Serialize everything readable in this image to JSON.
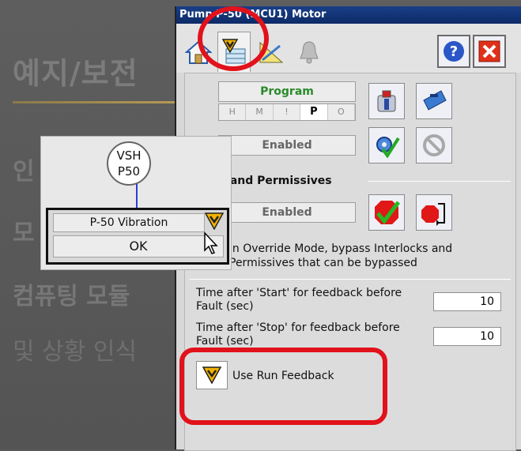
{
  "background_slide": {
    "title": "예지/보전",
    "lines": [
      "인",
      "모",
      "컴퓨팅 모듈",
      "및 상황 인식"
    ]
  },
  "window": {
    "title": "Pump P-50 (MCU1) Motor",
    "tabs": [
      {
        "name": "home",
        "icon": "home-icon"
      },
      {
        "name": "maintenance",
        "icon": "maintenance-wrench-icon",
        "active": true
      },
      {
        "name": "engineering",
        "icon": "engineering-ruler-icon"
      },
      {
        "name": "alarms",
        "icon": "bell-icon"
      }
    ],
    "help_icon": "question-mark-icon",
    "close_icon": "close-x-icon"
  },
  "mode": {
    "program_label": "Program",
    "mode_letters": [
      "H",
      "M",
      "!",
      "P",
      "O"
    ],
    "selected_mode": "P",
    "enabled_label_1": "Enabled",
    "enabled_label_2": "Enabled"
  },
  "interlocks": {
    "section_title": "cks and Permissives",
    "override_text": "in Override Mode, bypass Interlocks and Permissives that can be bypassed"
  },
  "feedback": {
    "start_label": "Time after 'Start' for feedback before Fault (sec)",
    "start_value": "10",
    "stop_label": "Time after 'Stop' for feedback before Fault (sec)",
    "stop_value": "10",
    "run_feedback_label": "Use Run Feedback"
  },
  "popup": {
    "tag_top": "VSH",
    "tag_bottom": "P50",
    "vibration_name": "P-50 Vibration",
    "vibration_value": "OK"
  },
  "colors": {
    "title_bar": "#0c2a66",
    "annotation_red": "#e1121b",
    "program_green": "#2a8a2a"
  }
}
